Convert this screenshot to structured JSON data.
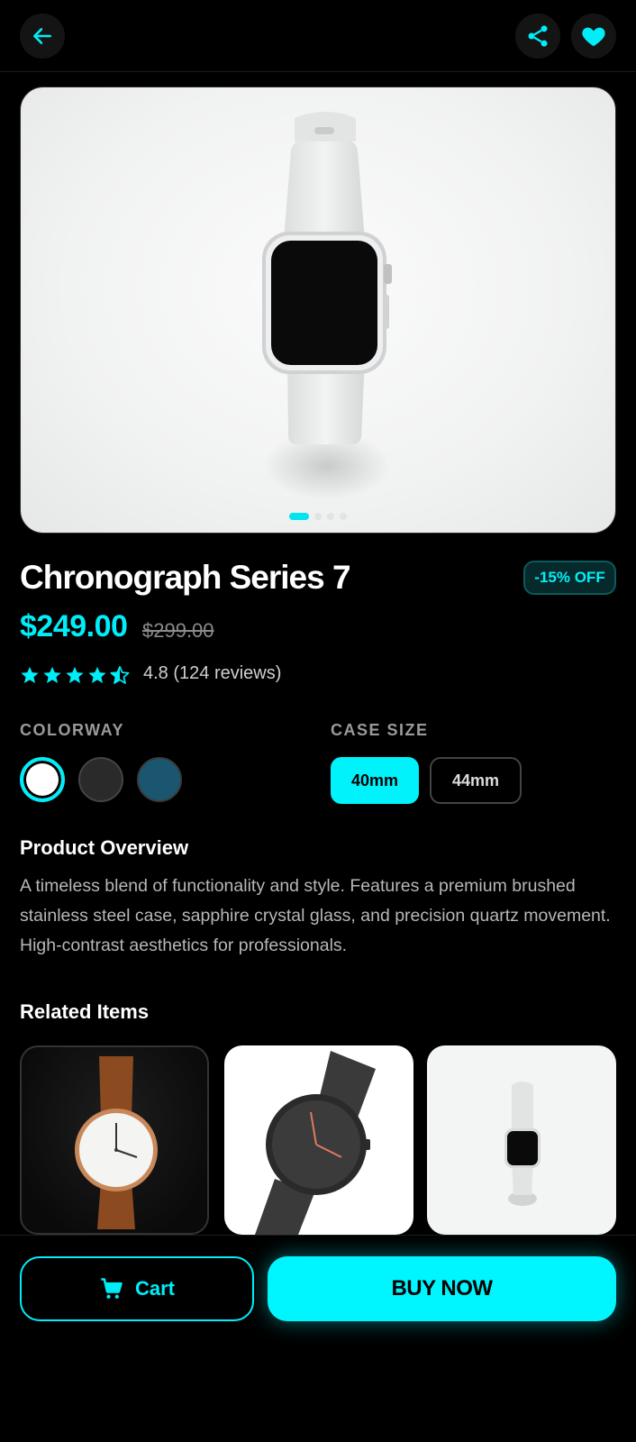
{
  "colors": {
    "accent": "#00EEF8",
    "background": "#000000"
  },
  "header": {
    "back_icon": "arrow-left-icon",
    "share_icon": "share-icon",
    "favorite_icon": "heart-icon"
  },
  "gallery": {
    "slide_count": 4,
    "active_index": 0
  },
  "product": {
    "title": "Chronograph Series 7",
    "discount_badge": "-15% OFF",
    "price": "$249.00",
    "old_price": "$299.00",
    "rating_value": 4.5,
    "rating_text": "4.8 (124 reviews)"
  },
  "options": {
    "colorway_label": "COLORWAY",
    "colorways": [
      {
        "name": "white",
        "color": "#FFFFFF",
        "selected": true
      },
      {
        "name": "black",
        "color": "#2A2A2A",
        "selected": false
      },
      {
        "name": "teal",
        "color": "#1A5670",
        "selected": false
      }
    ],
    "size_label": "CASE SIZE",
    "sizes": [
      {
        "label": "40mm",
        "selected": true
      },
      {
        "label": "44mm",
        "selected": false
      }
    ]
  },
  "overview": {
    "title": "Product Overview",
    "text": "A timeless blend of functionality and style. Features a premium brushed stainless steel case, sapphire crystal glass, and precision quartz movement. High-contrast aesthetics for professionals."
  },
  "related": {
    "title": "Related Items",
    "items": [
      {
        "name": "brown-leather-watch"
      },
      {
        "name": "black-mesh-watch"
      },
      {
        "name": "white-smart-watch"
      }
    ]
  },
  "actions": {
    "cart_label": "Cart",
    "cart_icon": "cart-icon",
    "buy_label": "BUY NOW"
  }
}
